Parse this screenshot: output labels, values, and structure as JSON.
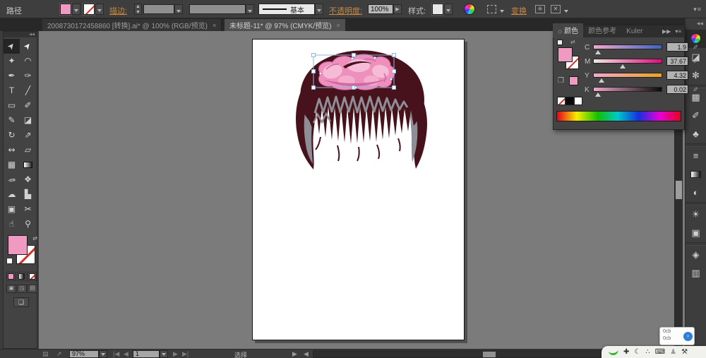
{
  "control_bar": {
    "selection_type": "路径",
    "fill_color": "#f09ac2",
    "stroke_label": "描边:",
    "brush_name": "基本",
    "opacity_label": "不透明度:",
    "opacity_value": "100%",
    "style_label": "样式:",
    "transform_label": "变换",
    "accent_color": "#c9873e"
  },
  "tabs": [
    {
      "title": "2008730172458860 [转换].ai* @ 100% (RGB/预览)",
      "close": "×"
    },
    {
      "title": "未标题-11* @ 97% (CMYK/预览)",
      "close": "×"
    }
  ],
  "toolbox": {
    "collapse": "◀◀",
    "tools": [
      {
        "name": "selection-tool",
        "glyph": "➤"
      },
      {
        "name": "direct-selection-tool",
        "glyph": "➤"
      },
      {
        "name": "magic-wand-tool",
        "glyph": "✦"
      },
      {
        "name": "lasso-tool",
        "glyph": "◠"
      },
      {
        "name": "pen-tool",
        "glyph": "✒"
      },
      {
        "name": "blob-brush-tool",
        "glyph": "✑"
      },
      {
        "name": "type-tool",
        "glyph": "T"
      },
      {
        "name": "line-segment-tool",
        "glyph": "╱"
      },
      {
        "name": "rectangle-tool",
        "glyph": "▭"
      },
      {
        "name": "paintbrush-tool",
        "glyph": "✐"
      },
      {
        "name": "pencil-tool",
        "glyph": "✎"
      },
      {
        "name": "eraser-tool",
        "glyph": "◪"
      },
      {
        "name": "rotate-tool",
        "glyph": "↻"
      },
      {
        "name": "scale-tool",
        "glyph": "⇗"
      },
      {
        "name": "width-tool",
        "glyph": "↭"
      },
      {
        "name": "free-transform-tool",
        "glyph": "▱"
      },
      {
        "name": "mesh-tool",
        "glyph": "▦"
      },
      {
        "name": "gradient-tool",
        "glyph": ""
      },
      {
        "name": "eyedropper-tool",
        "glyph": "✎"
      },
      {
        "name": "blend-tool",
        "glyph": "❖"
      },
      {
        "name": "symbol-sprayer-tool",
        "glyph": "☁"
      },
      {
        "name": "graph-tool",
        "glyph": "▙"
      },
      {
        "name": "artboard-tool",
        "glyph": "▣"
      },
      {
        "name": "slice-tool",
        "glyph": "✂"
      },
      {
        "name": "hand-tool",
        "glyph": "☝"
      },
      {
        "name": "zoom-tool",
        "glyph": "⚲"
      }
    ]
  },
  "color_panel": {
    "tabs": [
      {
        "label": "颜色"
      },
      {
        "label": "颜色参考"
      },
      {
        "label": "Kuler"
      }
    ],
    "collapse_icon": "◇",
    "expand_icon": "▶▶",
    "menu_icon": "▾≡",
    "swap_icon": "⇄",
    "cube_icon": "❒",
    "pen_icon": "✎",
    "grip": "·····",
    "sliders": [
      {
        "label": "C",
        "value": "1.9"
      },
      {
        "label": "M",
        "value": "37.67"
      },
      {
        "label": "Y",
        "value": "4.32"
      },
      {
        "label": "K",
        "value": "0.02"
      }
    ],
    "current_color": "#f09ac2"
  },
  "dock": {
    "collapse": "◀◀",
    "items": [
      {
        "name": "color-panel",
        "glyph": ""
      },
      {
        "name": "color-guide-panel",
        "glyph": "◪"
      },
      {
        "name": "kuler-panel",
        "glyph": "✻"
      },
      {
        "name": "swatches-panel",
        "glyph": "▦"
      },
      {
        "name": "brushes-panel",
        "glyph": "✐"
      },
      {
        "name": "symbols-panel",
        "glyph": "♣"
      },
      {
        "name": "stroke-panel",
        "glyph": "≡"
      },
      {
        "name": "gradient-panel",
        "glyph": ""
      },
      {
        "name": "transparency-panel",
        "glyph": "◐"
      },
      {
        "name": "appearance-panel",
        "glyph": "☀"
      },
      {
        "name": "graphic-styles-panel",
        "glyph": "▣"
      },
      {
        "name": "layers-panel",
        "glyph": "◈"
      },
      {
        "name": "artboards-panel",
        "glyph": "▥"
      }
    ]
  },
  "status_bar": {
    "doc_icon": "▤",
    "export_icon": "↗",
    "zoom": "97%",
    "nav_first": "|◀",
    "nav_prev": "◀",
    "artboard_number": "1",
    "nav_next": "▶",
    "nav_last": "▶|",
    "status": "选择",
    "scroll_right": "▶",
    "scroll_left": "◀"
  },
  "ime": {
    "icons": [
      {
        "name": "ime-mode-icon",
        "glyph": "✚"
      },
      {
        "name": "ime-halfmoon-icon",
        "glyph": "☾"
      },
      {
        "name": "ime-punct-icon",
        "glyph": "∴"
      },
      {
        "name": "ime-keyboard-icon",
        "glyph": "⌨"
      },
      {
        "name": "ime-user-icon",
        "glyph": "♟"
      },
      {
        "name": "ime-wrench-icon",
        "glyph": "⚒"
      }
    ],
    "popup_lines": [
      "0cb",
      "0cb"
    ],
    "badge": "›"
  },
  "artwork": {
    "hair_color": "#47121c",
    "highlight_color": "#8e8e96",
    "bow_color": "#ee8fbc",
    "bow_light": "#f6bcd7",
    "bow_dark": "#c85f9e",
    "selection_color": "#8fb6d8"
  }
}
